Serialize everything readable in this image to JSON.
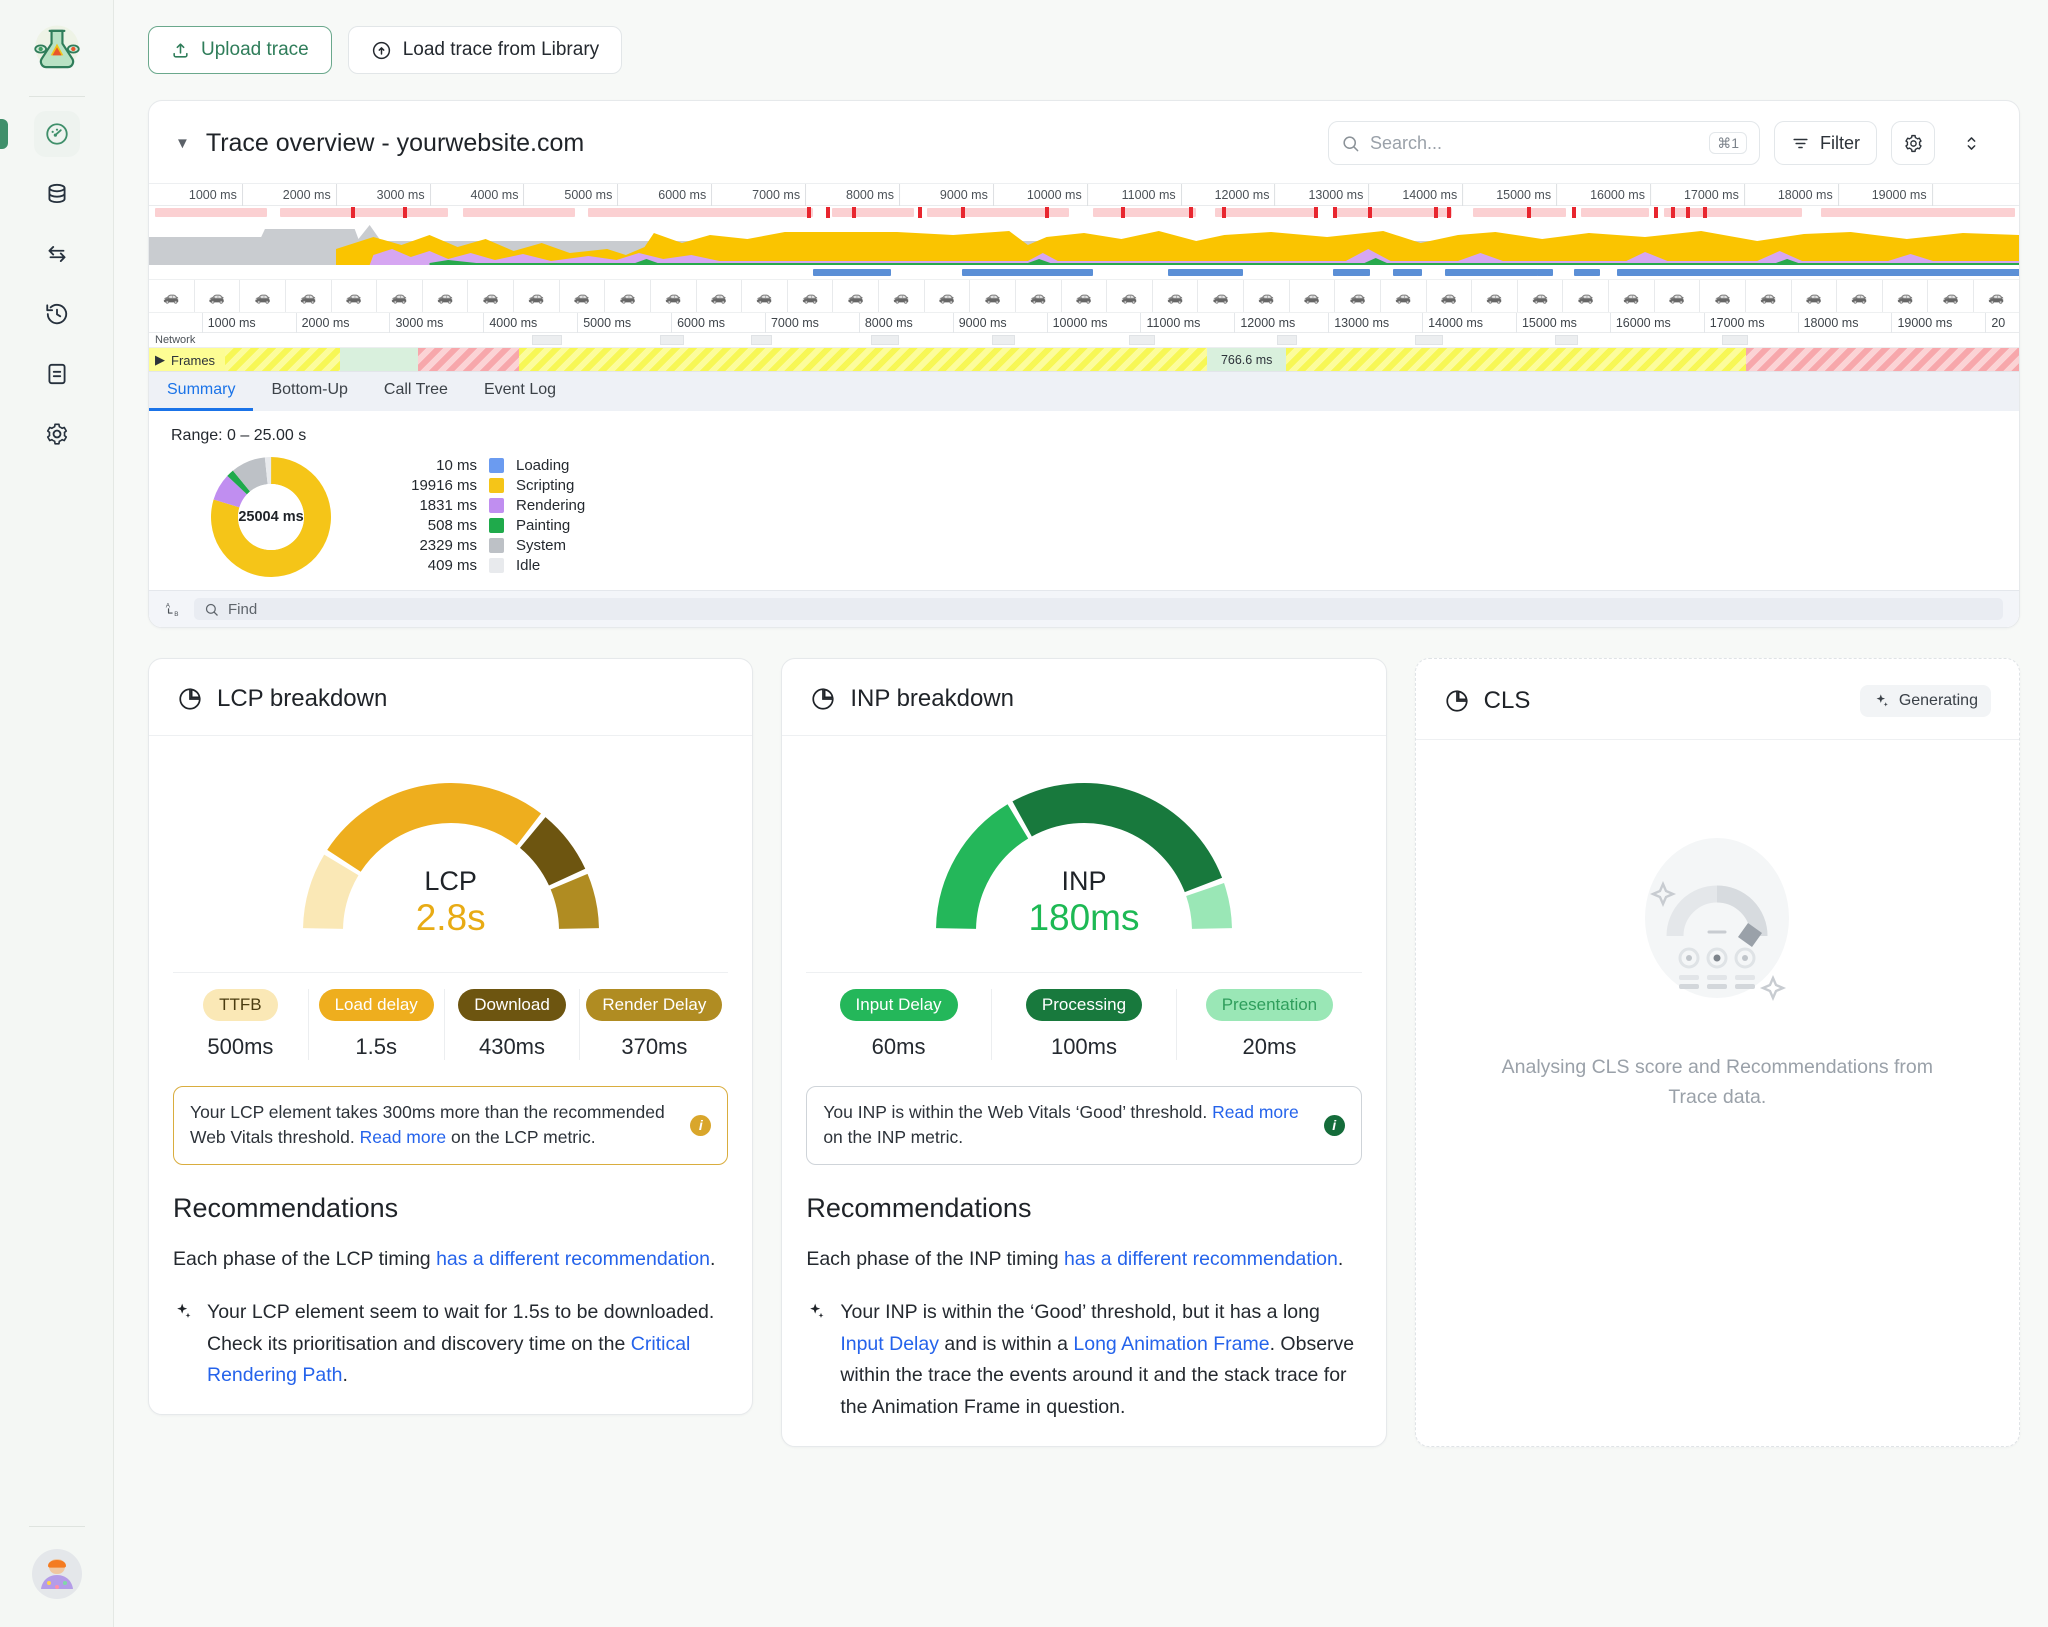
{
  "sidebar": {
    "logo_icon": "flask-logo",
    "items": [
      {
        "icon": "speedometer-icon",
        "name": "performance",
        "active": true
      },
      {
        "icon": "database-icon",
        "name": "data",
        "active": false
      },
      {
        "icon": "transfer-arrows-icon",
        "name": "compare",
        "active": false
      },
      {
        "icon": "history-clock-icon",
        "name": "history",
        "active": false
      },
      {
        "icon": "document-icon",
        "name": "reports",
        "active": false
      },
      {
        "icon": "gear-icon",
        "name": "settings",
        "active": false
      }
    ],
    "avatar_icon": "user-avatar"
  },
  "topbar": {
    "upload_label": "Upload trace",
    "upload_icon": "upload-icon",
    "library_label": "Load trace from Library",
    "library_icon": "cloud-upload-icon"
  },
  "trace": {
    "title": "Trace overview - yourwebsite.com",
    "caret_icon": "caret-down-icon",
    "search_placeholder": "Search...",
    "search_value": "",
    "search_shortcut": "⌘1",
    "search_icon": "search-icon",
    "filter_label": "Filter",
    "filter_icon": "filter-icon",
    "settings_icon": "gear-icon",
    "expand_icon": "chevron-updown-icon",
    "ruler_ticks": [
      "1000 ms",
      "2000 ms",
      "3000 ms",
      "4000 ms",
      "5000 ms",
      "6000 ms",
      "7000 ms",
      "8000 ms",
      "9000 ms",
      "10000 ms",
      "11000 ms",
      "12000 ms",
      "13000 ms",
      "14000 ms",
      "15000 ms",
      "16000 ms",
      "17000 ms",
      "18000 ms",
      "19000 ms"
    ],
    "ruler2_ticks": [
      "1000 ms",
      "2000 ms",
      "3000 ms",
      "4000 ms",
      "5000 ms",
      "6000 ms",
      "7000 ms",
      "8000 ms",
      "9000 ms",
      "10000 ms",
      "11000 ms",
      "12000 ms",
      "13000 ms",
      "14000 ms",
      "15000 ms",
      "16000 ms",
      "17000 ms",
      "18000 ms",
      "19000 ms",
      "20"
    ],
    "network_label": "Network",
    "frames_label": "Frames",
    "frames_icon": "caret-right-icon",
    "frame_duration": "766.6 ms",
    "tabs": [
      {
        "label": "Summary",
        "active": true
      },
      {
        "label": "Bottom-Up",
        "active": false
      },
      {
        "label": "Call Tree",
        "active": false
      },
      {
        "label": "Event Log",
        "active": false
      }
    ],
    "range": "Range: 0 – 25.00 s",
    "find_placeholder": "Find",
    "find_icon": "search-icon",
    "find_ab_icon": "a-to-b-icon"
  },
  "chart_data": {
    "type": "pie",
    "title": "Trace activity breakdown",
    "center_label": "25004 ms",
    "total_ms": 25004,
    "categories": [
      "Loading",
      "Scripting",
      "Rendering",
      "Painting",
      "System",
      "Idle"
    ],
    "values": [
      10,
      19916,
      1831,
      508,
      2329,
      409
    ],
    "value_labels": [
      "10 ms",
      "19916 ms",
      "1831 ms",
      "508 ms",
      "2329 ms",
      "409 ms"
    ],
    "colors": [
      "#6b9bf0",
      "#f5c518",
      "#c08ef0",
      "#1faa4b",
      "#bdc1c6",
      "#e8eaed"
    ],
    "legend_position": "right"
  },
  "lcp": {
    "title": "LCP breakdown",
    "title_icon": "pie-chart-icon",
    "metric_name": "LCP",
    "metric_value": "2.8s",
    "metric_color": "#e8ab14",
    "gauge": {
      "type": "gauge",
      "segments": [
        {
          "label": "TTFB",
          "value_ms": 500,
          "value_label": "500ms",
          "color": "#fae8b6",
          "text_color": "#4a3c10"
        },
        {
          "label": "Load delay",
          "value_ms": 1500,
          "value_label": "1.5s",
          "color": "#eeae1e",
          "text_color": "#ffffff"
        },
        {
          "label": "Download",
          "value_ms": 430,
          "value_label": "430ms",
          "color": "#6d5510",
          "text_color": "#ffffff"
        },
        {
          "label": "Render Delay",
          "value_ms": 370,
          "value_label": "370ms",
          "color": "#b08c22",
          "text_color": "#ffffff"
        }
      ]
    },
    "note_text_1": "Your LCP element takes 300ms more than the recommended Web Vitals threshold. ",
    "note_link": "Read more",
    "note_text_2": " on the LCP metric.",
    "note_icon": "info-icon",
    "rec_title": "Recommendations",
    "rec_lead_1": "Each phase of the LCP timing ",
    "rec_lead_link": "has a  different recommendation",
    "rec_lead_2": ".",
    "rec_item_icon": "sparkle-icon",
    "rec_item_1": "Your LCP element seem to wait for 1.5s to be downloaded. Check its prioritisation and discovery time on the ",
    "rec_item_link": "Critical Rendering Path",
    "rec_item_2": "."
  },
  "inp": {
    "title": "INP breakdown",
    "title_icon": "pie-chart-icon",
    "metric_name": "INP",
    "metric_value": "180ms",
    "metric_color": "#1db954",
    "gauge": {
      "type": "gauge",
      "segments": [
        {
          "label": "Input Delay",
          "value_ms": 60,
          "value_label": "60ms",
          "color": "#24b75a",
          "text_color": "#ffffff"
        },
        {
          "label": "Processing",
          "value_ms": 100,
          "value_label": "100ms",
          "color": "#18793d",
          "text_color": "#ffffff"
        },
        {
          "label": "Presentation",
          "value_ms": 20,
          "value_label": "20ms",
          "color": "#9ae7b6",
          "text_color": "#2f9e5c"
        }
      ]
    },
    "note_text_1": "You INP is within the Web Vitals ‘Good’  threshold. ",
    "note_link": "Read more",
    "note_text_2": " on the INP metric.",
    "note_icon": "info-icon",
    "rec_title": "Recommendations",
    "rec_lead_1": "Each phase of the INP timing ",
    "rec_lead_link": "has a different recommendation",
    "rec_lead_2": ".",
    "rec_item_icon": "sparkle-icon",
    "rec_item_1": "Your INP is within the ‘Good’  threshold, but it has a long ",
    "rec_item_link_1": "Input Delay",
    "rec_item_2": " and is within a ",
    "rec_item_link_2": "Long Animation Frame",
    "rec_item_3": ". Observe within the trace the events around it and the stack trace for the Animation Frame in question."
  },
  "cls": {
    "title": "CLS",
    "title_icon": "pie-chart-icon",
    "badge_label": "Generating",
    "badge_icon": "sparkle-icon",
    "placeholder_icon": "gauge-skeleton-illustration",
    "status_text": "Analysing CLS score and Recommendations from Trace data."
  }
}
